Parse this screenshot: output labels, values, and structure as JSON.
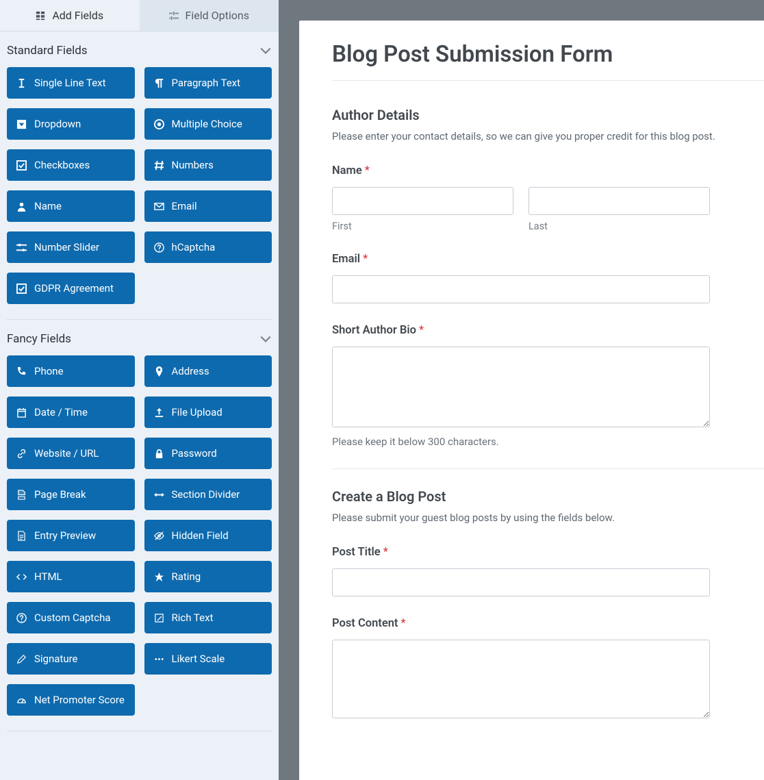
{
  "tabs": {
    "add_fields": "Add Fields",
    "field_options": "Field Options"
  },
  "sections": {
    "standard": {
      "title": "Standard Fields"
    },
    "fancy": {
      "title": "Fancy Fields"
    }
  },
  "standard_fields": {
    "single_line": "Single Line Text",
    "paragraph": "Paragraph Text",
    "dropdown": "Dropdown",
    "multiple": "Multiple Choice",
    "checkboxes": "Checkboxes",
    "numbers": "Numbers",
    "name": "Name",
    "email": "Email",
    "slider": "Number Slider",
    "hcaptcha": "hCaptcha",
    "gdpr": "GDPR Agreement"
  },
  "fancy_fields": {
    "phone": "Phone",
    "address": "Address",
    "datetime": "Date / Time",
    "upload": "File Upload",
    "website": "Website / URL",
    "password": "Password",
    "pagebreak": "Page Break",
    "sectdiv": "Section Divider",
    "entryprev": "Entry Preview",
    "hidden": "Hidden Field",
    "html": "HTML",
    "rating": "Rating",
    "captcha": "Custom Captcha",
    "richtext": "Rich Text",
    "signature": "Signature",
    "likert": "Likert Scale",
    "nps": "Net Promoter Score"
  },
  "form": {
    "title": "Blog Post Submission Form",
    "author": {
      "heading": "Author Details",
      "desc": "Please enter your contact details, so we can give you proper credit for this blog post.",
      "name_label": "Name",
      "first_sub": "First",
      "last_sub": "Last",
      "email_label": "Email",
      "bio_label": "Short Author Bio",
      "bio_hint": "Please keep it below 300 characters."
    },
    "post": {
      "heading": "Create a Blog Post",
      "desc": "Please submit your guest blog posts by using the fields below.",
      "title_label": "Post Title",
      "content_label": "Post Content"
    },
    "required_mark": "*"
  }
}
